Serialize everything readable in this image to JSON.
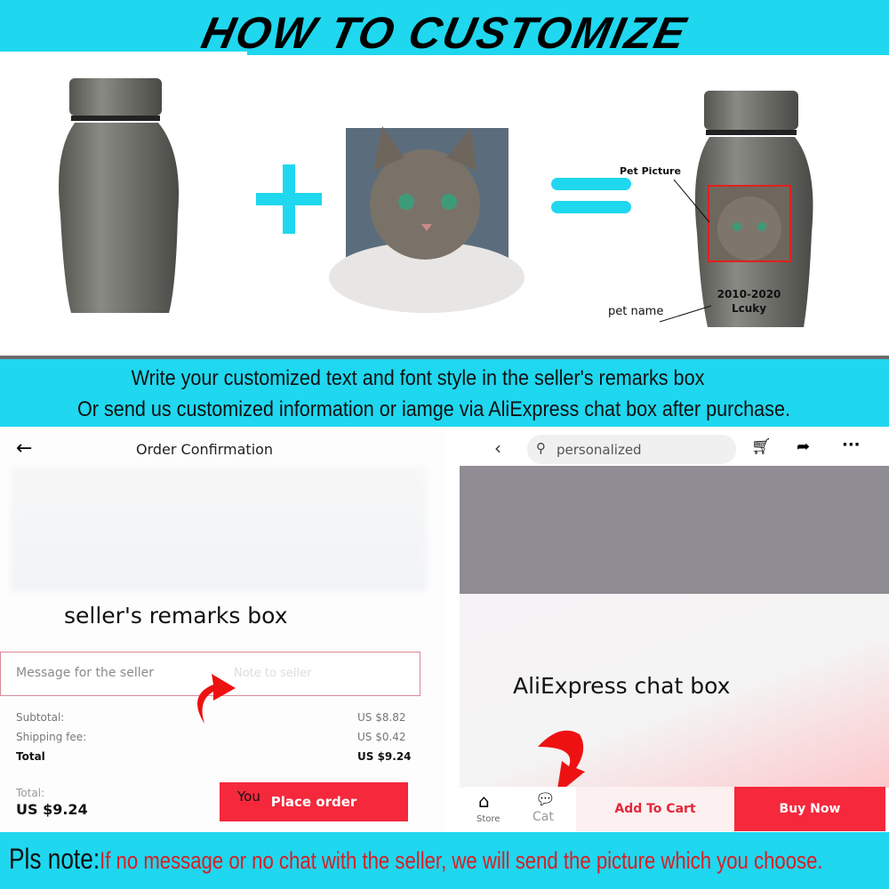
{
  "header": {
    "title": "HOW TO CUSTOMIZE"
  },
  "diagram": {
    "plus": "+",
    "pet_picture_label": "Pet Picture",
    "pet_name_label": "pet name",
    "urn_dates": "2010-2020",
    "urn_name": "Lcuky"
  },
  "instructions": {
    "line1": "Write your customized text and font style in the seller's remarks box",
    "line2": "Or send us customized information or iamge via AliExpress chat box after purchase."
  },
  "order": {
    "title": "Order Confirmation",
    "caption": "seller's remarks box",
    "message_label": "Message for the seller",
    "message_placeholder": "Note to seller",
    "rows": [
      {
        "label": "Subtotal:",
        "value": "US $8.82"
      },
      {
        "label": "Shipping fee:",
        "value": "US $0.42"
      },
      {
        "label": "Total",
        "value": "US $9.24"
      }
    ],
    "total_label": "Total:",
    "total_value": "US $9.24",
    "watermark": "You",
    "place_order": "Place order"
  },
  "product": {
    "search_value": "personalized",
    "caption": "AliExpress chat box",
    "store": "Store",
    "chat": "Cat",
    "add_to_cart": "Add To Cart",
    "buy_now": "Buy Now"
  },
  "note": {
    "prefix": "Pls note:",
    "text": "If no message or no chat with the seller, we will send the picture which you choose."
  },
  "colors": {
    "accent": "#1fd7ef",
    "red": "#f5283c",
    "urn": "#6b6b68"
  }
}
